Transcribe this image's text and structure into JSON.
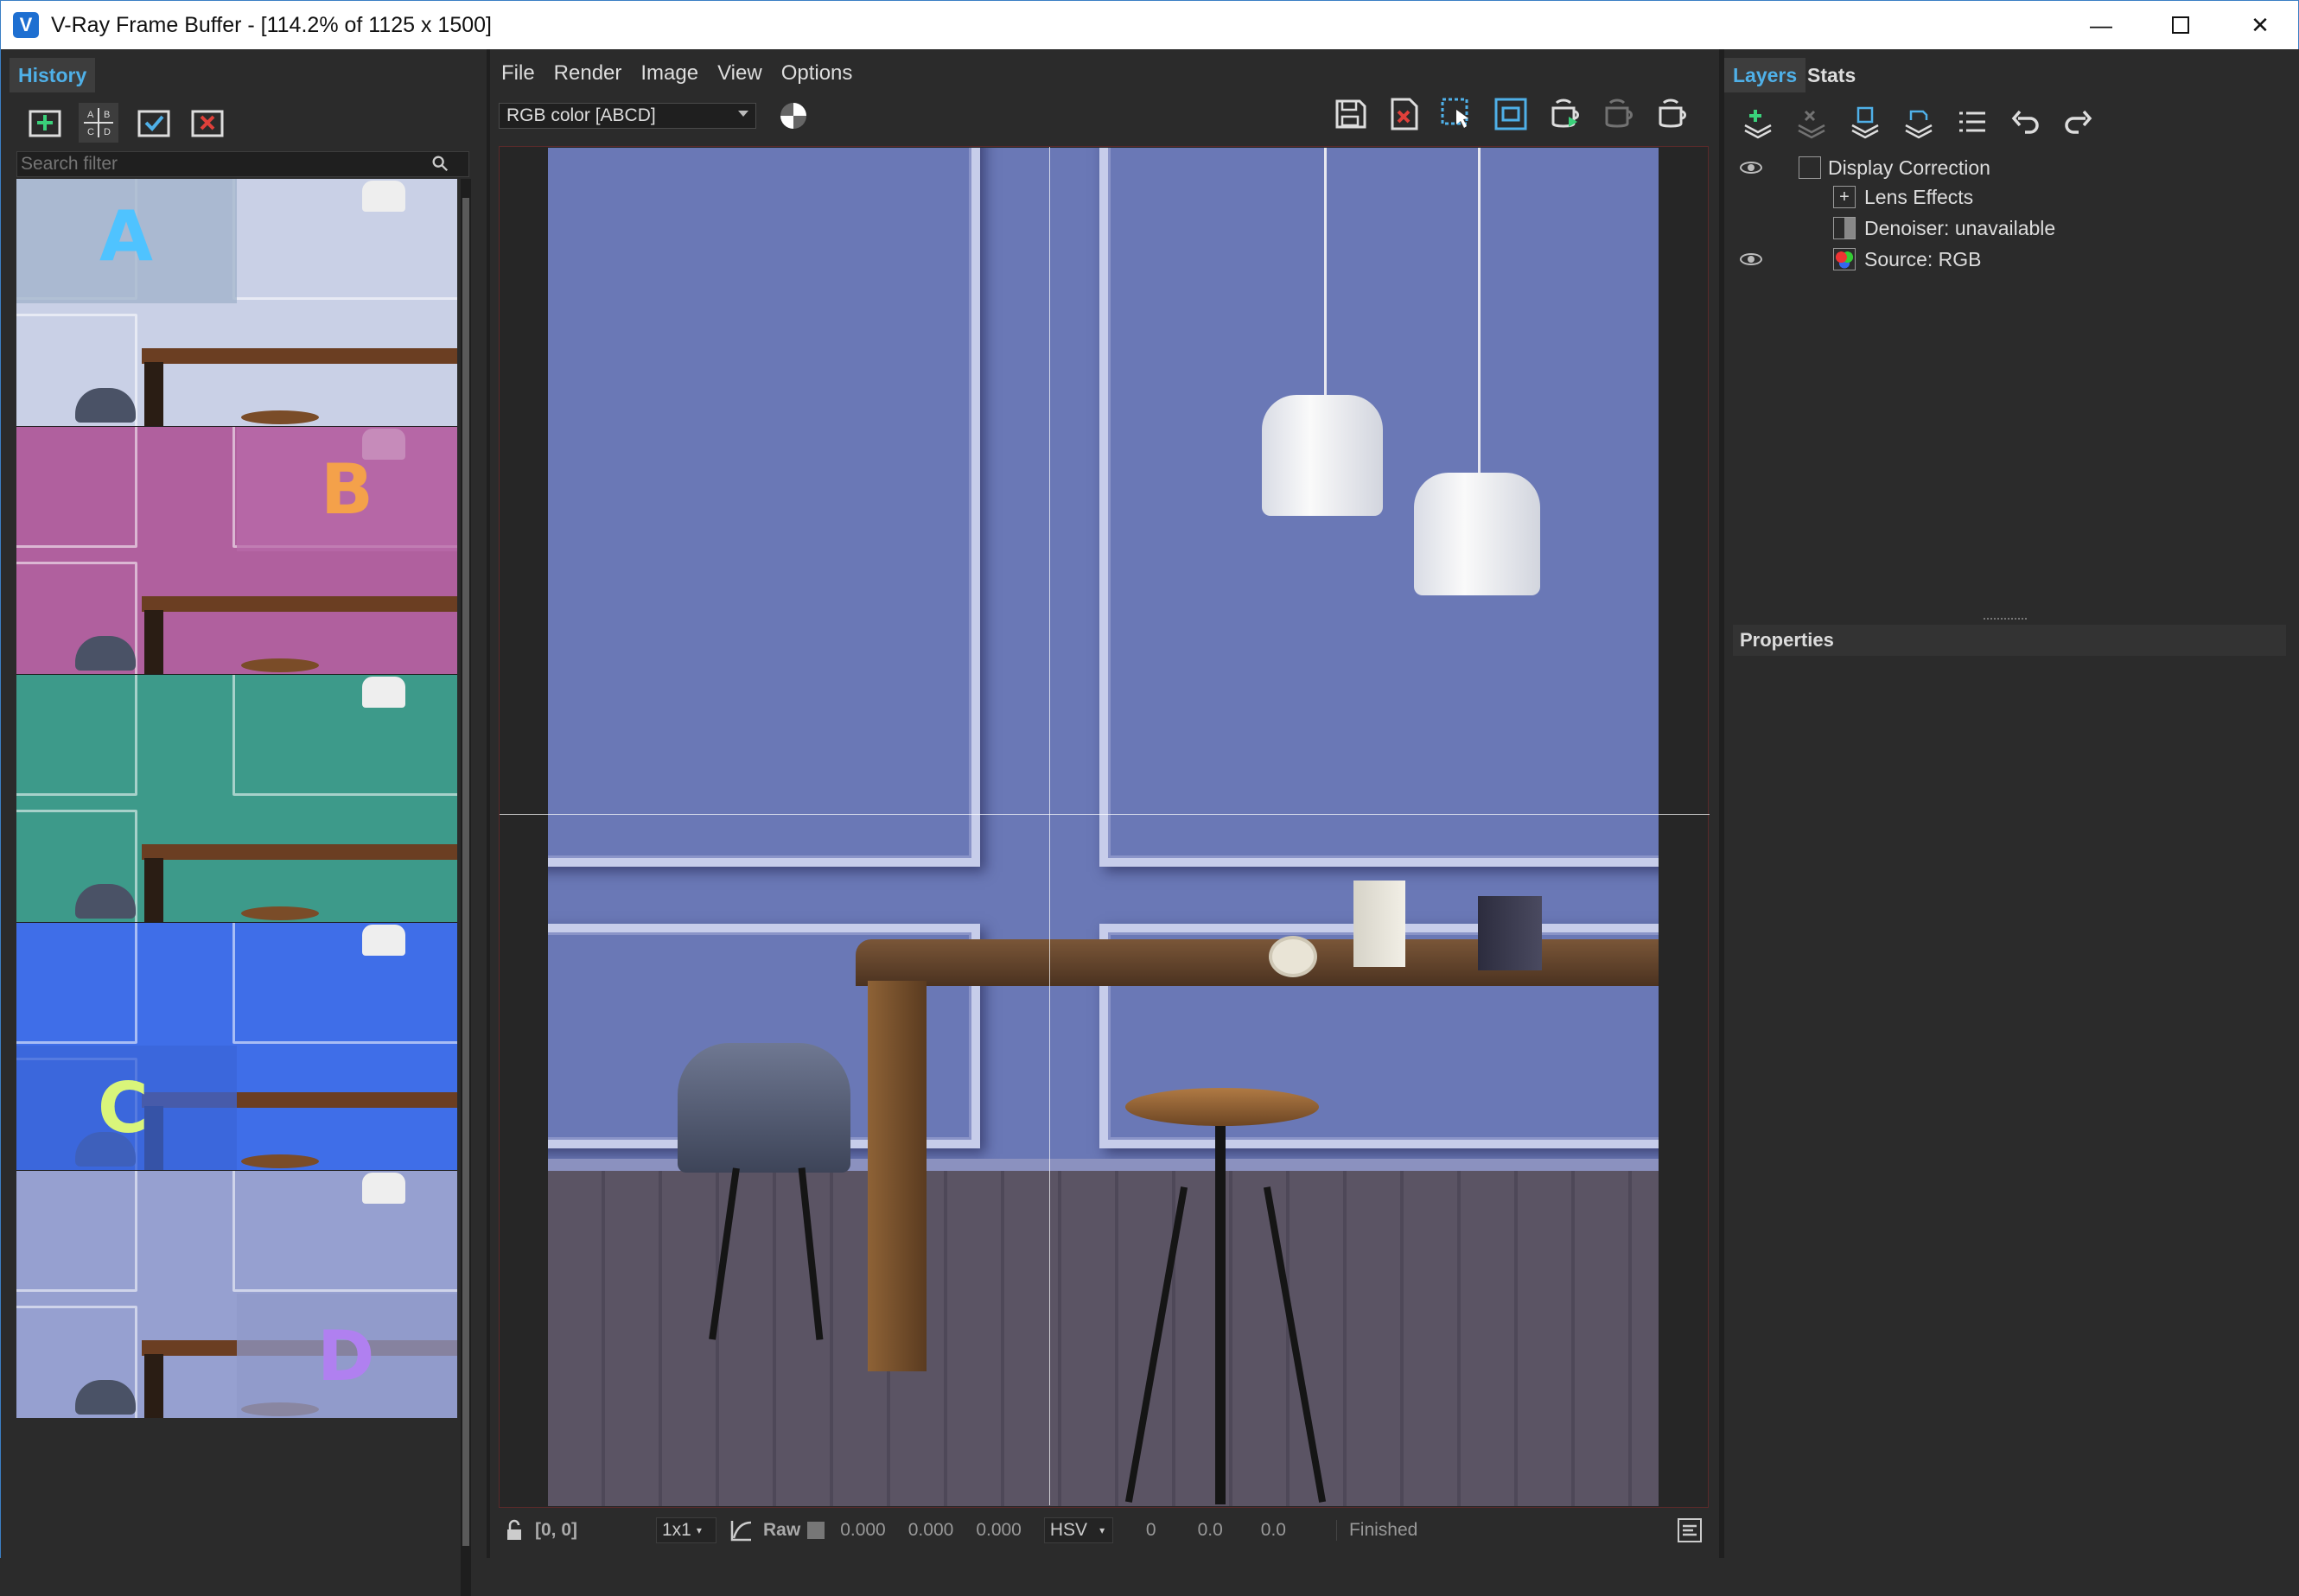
{
  "window": {
    "title": "V-Ray Frame Buffer - [114.2% of 1125 x 1500]",
    "app_icon": "V",
    "minimize": "—",
    "close": "✕"
  },
  "history": {
    "tab_label": "History",
    "toolbar_icons": [
      "save-to-history-icon",
      "ab-compare-icon",
      "load-history-icon",
      "remove-history-icon"
    ],
    "compare_letters": {
      "a": "A",
      "b": "B",
      "c": "C",
      "d": "D"
    },
    "search_placeholder": "Search filter",
    "thumbnails": [
      {
        "label": "A",
        "tint": "#9fb1c9",
        "letter_color": "#4fc3ff",
        "wall": "#c9d0e6"
      },
      {
        "label": "B",
        "tint": "#b86aa8",
        "letter_color": "#f4a14a",
        "wall": "#b0609e"
      },
      {
        "label": "",
        "tint": "#3c9a88",
        "letter_color": "#ffffff",
        "wall": "#3d9a8a"
      },
      {
        "label": "C",
        "tint": "#3b66d8",
        "letter_color": "#d9f57a",
        "wall": "#3f6ee8"
      },
      {
        "label": "D",
        "tint": "#8f9ac9",
        "letter_color": "#b080f0",
        "wall": "#96a0d0"
      }
    ]
  },
  "menu": [
    "File",
    "Render",
    "Image",
    "View",
    "Options"
  ],
  "channel": {
    "selected": "RGB color [ABCD]"
  },
  "toolbar_icons": [
    "save-image-icon",
    "clear-image-icon",
    "region-render-icon",
    "track-mouse-icon",
    "render-interactive-icon",
    "stop-render-icon",
    "render-icon"
  ],
  "status": {
    "coords": "[0, 0]",
    "zoom": "1x1",
    "raw_label": "Raw",
    "r": "0.000",
    "g": "0.000",
    "b": "0.000",
    "color_mode": "HSV",
    "h": "0",
    "s": "0.0",
    "v": "0.0",
    "state": "Finished"
  },
  "layers": {
    "tab_layers": "Layers",
    "tab_stats": "Stats",
    "toolbar_icons": [
      "add-layer-icon",
      "delete-layer-icon",
      "save-layers-icon",
      "load-layers-icon",
      "layer-list-icon",
      "undo-icon",
      "redo-icon"
    ],
    "items": [
      {
        "name": "Display Correction",
        "visible": true,
        "icon": "curve-icon"
      },
      {
        "name": "Lens Effects",
        "visible": false,
        "icon": "lens-effects-icon"
      },
      {
        "name": "Denoiser: unavailable",
        "visible": false,
        "icon": "denoiser-icon"
      },
      {
        "name": "Source: RGB",
        "visible": true,
        "icon": "rgb-source-icon"
      }
    ],
    "properties_title": "Properties"
  },
  "colors": {
    "accent": "#4fb0e8",
    "panel_bg": "#2b2b2b",
    "render_wall": "#6a78b6"
  }
}
